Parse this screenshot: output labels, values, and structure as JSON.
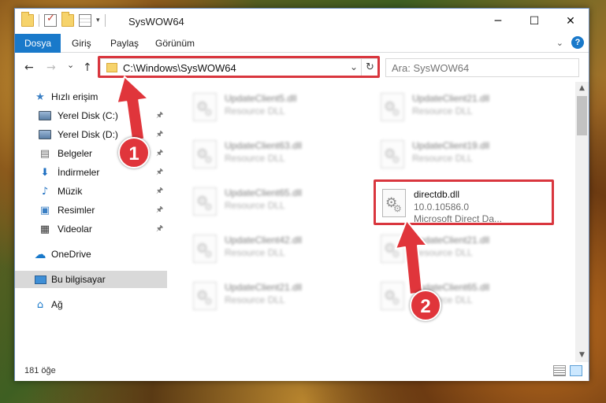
{
  "window": {
    "title": "SysWOW64",
    "controls": {
      "minimize": "─",
      "maximize": "☐",
      "close": "✕"
    }
  },
  "ribbon": {
    "tabs": [
      "Dosya",
      "Giriş",
      "Paylaş",
      "Görünüm"
    ],
    "accent_color": "#1979ca",
    "help_label": "?"
  },
  "address": {
    "path": "C:\\Windows\\SysWOW64",
    "search_placeholder": "Ara: SysWOW64",
    "nav": {
      "back": "←",
      "forward": "→",
      "recent": "⌄",
      "up": "↑"
    },
    "refresh": "↻",
    "dropdown": "⌄"
  },
  "sidebar": {
    "items": [
      {
        "label": "Hızlı erişim",
        "icon": "star-icon",
        "glyph": "★",
        "color": "#3a7fc4",
        "pinned": false
      },
      {
        "label": "Yerel Disk (C:)",
        "icon": "disk-icon",
        "glyph": "",
        "color": "#5a7fa6",
        "pinned": true
      },
      {
        "label": "Yerel Disk (D:)",
        "icon": "disk-icon",
        "glyph": "",
        "color": "#5a7fa6",
        "pinned": true
      },
      {
        "label": "Belgeler",
        "icon": "documents-icon",
        "glyph": "▤",
        "color": "#6b6b6b",
        "pinned": true
      },
      {
        "label": "İndirmeler",
        "icon": "download-icon",
        "glyph": "⬇",
        "color": "#1e6fc1",
        "pinned": true
      },
      {
        "label": "Müzik",
        "icon": "music-icon",
        "glyph": "♪",
        "color": "#1e6fc1",
        "pinned": true
      },
      {
        "label": "Resimler",
        "icon": "pictures-icon",
        "glyph": "▣",
        "color": "#3a7fc4",
        "pinned": true
      },
      {
        "label": "Videolar",
        "icon": "video-icon",
        "glyph": "▦",
        "color": "#333333",
        "pinned": true
      },
      {
        "label": "OneDrive",
        "icon": "cloud-icon",
        "glyph": "☁",
        "color": "#1979ca",
        "pinned": false
      },
      {
        "label": "Bu bilgisayar",
        "icon": "computer-icon",
        "glyph": "🖵",
        "color": "#1979ca",
        "pinned": false,
        "selected": true
      },
      {
        "label": "Ağ",
        "icon": "network-icon",
        "glyph": "⌂",
        "color": "#1979ca",
        "pinned": false
      }
    ],
    "pin_glyph": "📌"
  },
  "files": [
    {
      "name": "UpdateClient5.dll",
      "type": "Resource DLL",
      "blurred": true
    },
    {
      "name": "UpdateClient21.dll",
      "type": "Resource DLL",
      "blurred": true
    },
    {
      "name": "UpdateClient63.dll",
      "type": "Resource DLL",
      "blurred": true
    },
    {
      "name": "UpdateClient19.dll",
      "type": "Resource DLL",
      "blurred": true
    },
    {
      "name": "UpdateClient65.dll",
      "type": "Resource DLL",
      "blurred": true
    },
    {
      "name": "directdb.dll",
      "version": "10.0.10586.0",
      "type": "Microsoft Direct Da...",
      "blurred": false,
      "highlighted": true
    },
    {
      "name": "UpdateClient42.dll",
      "type": "Resource DLL",
      "blurred": true
    },
    {
      "name": "UpdateClient21.dll",
      "type": "Resource DLL",
      "blurred": true
    },
    {
      "name": "UpdateClient21.dll",
      "type": "Resource DLL",
      "blurred": true
    },
    {
      "name": "UpdateClient65.dll",
      "type": "Resource DLL",
      "blurred": true
    }
  ],
  "status": {
    "item_count": "181 öğe"
  },
  "annotations": {
    "badges": [
      "1",
      "2"
    ],
    "color": "#d9363e"
  }
}
